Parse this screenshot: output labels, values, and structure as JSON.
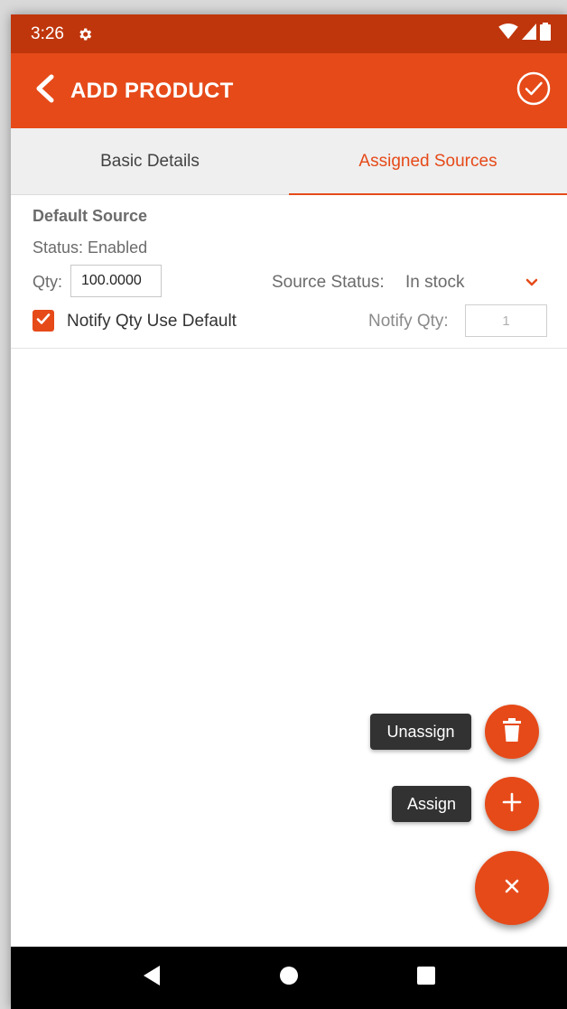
{
  "status_bar": {
    "time": "3:26",
    "icons": [
      "gear-icon",
      "wifi-icon",
      "signal-icon",
      "battery-icon"
    ]
  },
  "app_bar": {
    "title": "ADD PRODUCT",
    "back_icon": "chevron-left-icon",
    "confirm_icon": "check-circle-icon"
  },
  "tabs": [
    {
      "label": "Basic Details",
      "active": false
    },
    {
      "label": "Assigned Sources",
      "active": true
    }
  ],
  "source": {
    "name": "Default Source",
    "status": "Status: Enabled",
    "qty_label": "Qty:",
    "qty_value": "100.0000",
    "source_status_label": "Source Status:",
    "source_status_value": "In stock",
    "notify_checkbox_label": "Notify Qty Use Default",
    "notify_checked": true,
    "notify_qty_label": "Notify Qty:",
    "notify_qty_value": "1"
  },
  "fab": {
    "unassign_label": "Unassign",
    "assign_label": "Assign",
    "unassign_icon": "trash-icon",
    "assign_icon": "plus-icon",
    "main_icon": "close-icon"
  },
  "nav_bar": {
    "icons": [
      "back-triangle-icon",
      "home-circle-icon",
      "recents-square-icon"
    ]
  },
  "colors": {
    "status_bar": "#bf360c",
    "accent": "#e64a19",
    "tab_background": "#efefef",
    "tooltip": "#323232"
  }
}
